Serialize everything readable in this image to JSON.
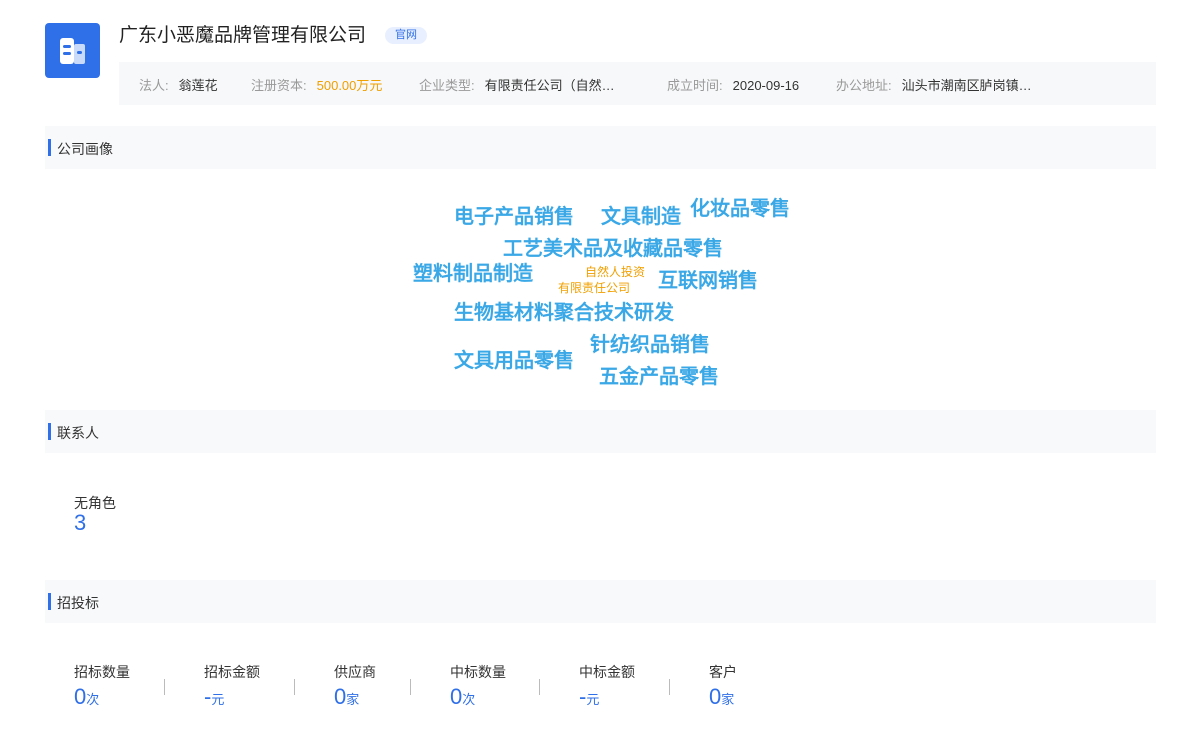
{
  "company": {
    "name": "广东小恶魔品牌管理有限公司",
    "official_tag": "官网",
    "brand_color": "#2f6fe8",
    "logo_icon": "building-icon"
  },
  "info": {
    "legal_person": {
      "label": "法人:",
      "value": "翁莲花"
    },
    "capital": {
      "label": "注册资本:",
      "value": "500.00万元"
    },
    "type": {
      "label": "企业类型:",
      "value": "有限责任公司（自然…"
    },
    "founded": {
      "label": "成立时间:",
      "value": "2020-09-16"
    },
    "address": {
      "label": "办公地址:",
      "value": "汕头市潮南区胪岗镇…"
    }
  },
  "sections": {
    "portrait": "公司画像",
    "contacts": "联系人",
    "bidding": "招投标"
  },
  "word_cloud": [
    "电子产品销售",
    "文具制造",
    "化妆品零售",
    "工艺美术品及收藏品零售",
    "塑料制品制造",
    "自然人投资",
    "有限责任公司",
    "互联网销售",
    "生物基材料聚合技术研发",
    "针纺织品销售",
    "文具用品零售",
    "五金产品零售"
  ],
  "contacts": {
    "label": "无角色",
    "value": "3"
  },
  "bidding": [
    {
      "label": "招标数量",
      "value": "0",
      "unit": "次"
    },
    {
      "label": "招标金额",
      "value": "-",
      "unit": "元"
    },
    {
      "label": "供应商",
      "value": "0",
      "unit": "家"
    },
    {
      "label": "中标数量",
      "value": "0",
      "unit": "次"
    },
    {
      "label": "中标金额",
      "value": "-",
      "unit": "元"
    },
    {
      "label": "客户",
      "value": "0",
      "unit": "家"
    }
  ]
}
